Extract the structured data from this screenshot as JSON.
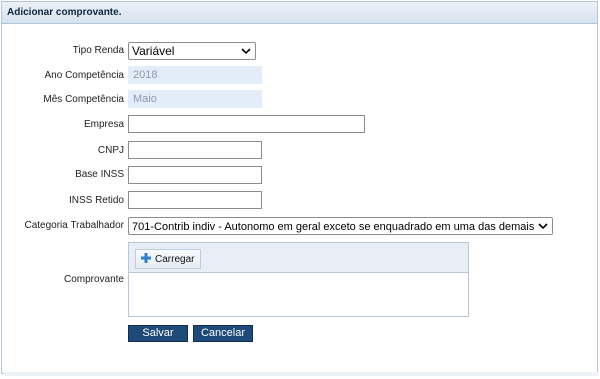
{
  "header": {
    "title": "Adicionar comprovante."
  },
  "form": {
    "tipo_renda": {
      "label": "Tipo Renda",
      "value": "Variável"
    },
    "ano_competencia": {
      "label": "Ano Competência",
      "value": "2018"
    },
    "mes_competencia": {
      "label": "Mês Competência",
      "value": "Maio"
    },
    "empresa": {
      "label": "Empresa",
      "value": ""
    },
    "cnpj": {
      "label": "CNPJ",
      "value": ""
    },
    "base_inss": {
      "label": "Base INSS",
      "value": ""
    },
    "inss_retido": {
      "label": "INSS Retido",
      "value": ""
    },
    "categoria_trabalhador": {
      "label": "Categoria Trabalhador",
      "value": "701-Contrib indiv - Autonomo em geral exceto se enquadrado em uma das demais"
    },
    "comprovante": {
      "label": "Comprovante",
      "upload_label": "Carregar"
    }
  },
  "actions": {
    "save_label": "Salvar",
    "cancel_label": "Cancelar"
  },
  "icons": {
    "upload": "plus-icon",
    "dropdown": "chevron-down-icon"
  },
  "colors": {
    "primary_button": "#1d4a78",
    "header_bg": "#dbe5f1",
    "readonly_bg": "#e3edf9",
    "upload_plus": "#2f7fd0"
  }
}
